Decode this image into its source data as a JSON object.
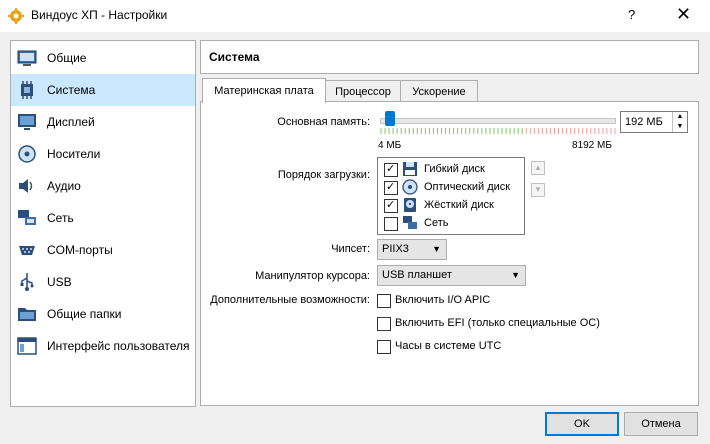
{
  "window": {
    "title": "Виндоус ХП - Настройки",
    "help_label": "?",
    "close_label": "✕"
  },
  "sidebar": {
    "items": [
      {
        "label": "Общие",
        "icon": "general-icon"
      },
      {
        "label": "Система",
        "icon": "system-icon",
        "selected": true
      },
      {
        "label": "Дисплей",
        "icon": "display-icon"
      },
      {
        "label": "Носители",
        "icon": "storage-icon"
      },
      {
        "label": "Аудио",
        "icon": "audio-icon"
      },
      {
        "label": "Сеть",
        "icon": "network-icon"
      },
      {
        "label": "COM-порты",
        "icon": "serial-ports-icon"
      },
      {
        "label": "USB",
        "icon": "usb-icon"
      },
      {
        "label": "Общие папки",
        "icon": "shared-folders-icon"
      },
      {
        "label": "Интерфейс пользователя",
        "icon": "user-interface-icon"
      }
    ]
  },
  "header": {
    "title": "Система"
  },
  "tabs": [
    {
      "label": "Материнская плата",
      "active": true
    },
    {
      "label": "Процессор",
      "active": false
    },
    {
      "label": "Ускорение",
      "active": false
    }
  ],
  "memory": {
    "label": "Основная память:",
    "min_label": "4 МБ",
    "max_label": "8192 МБ",
    "value": "192 МБ",
    "value_mb": 192,
    "max_mb": 8192
  },
  "boot": {
    "label": "Порядок загрузки:",
    "items": [
      {
        "label": "Гибкий диск",
        "checked": true,
        "icon": "floppy-icon"
      },
      {
        "label": "Оптический диск",
        "checked": true,
        "icon": "optical-disc-icon"
      },
      {
        "label": "Жёсткий диск",
        "checked": true,
        "icon": "hard-disk-icon"
      },
      {
        "label": "Сеть",
        "checked": false,
        "icon": "network-boot-icon"
      }
    ]
  },
  "chipset": {
    "label": "Чипсет:",
    "value": "PIIX3"
  },
  "pointing": {
    "label": "Манипулятор курсора:",
    "value": "USB планшет"
  },
  "extended": {
    "label": "Дополнительные возможности:",
    "options": [
      {
        "label": "Включить I/O APIC",
        "checked": false
      },
      {
        "label": "Включить EFI (только специальные ОС)",
        "checked": false
      },
      {
        "label": "Часы в системе UTC",
        "checked": false
      }
    ]
  },
  "buttons": {
    "ok": "OK",
    "cancel": "Отмена"
  },
  "colors": {
    "accent": "#0078d7",
    "selected": "#cce8ff",
    "ok_range": "#7ec864",
    "warn_range": "#f0a0a0"
  }
}
